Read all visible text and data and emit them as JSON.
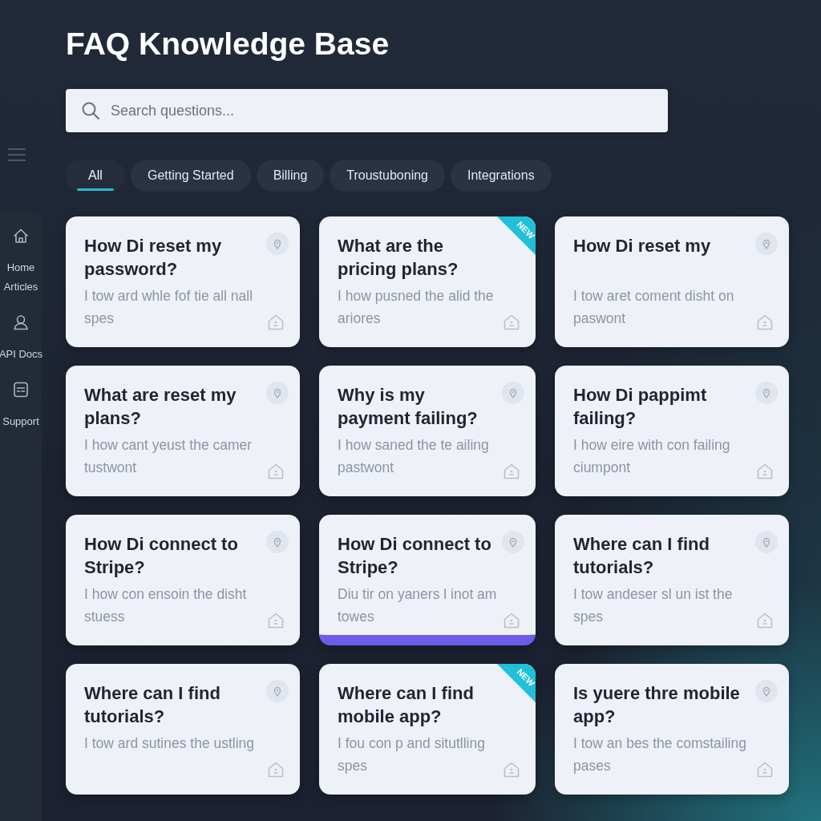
{
  "sidebar": {
    "items": [
      {
        "label": "Home",
        "kind": "icon"
      },
      {
        "label": "Articles",
        "kind": "text"
      },
      {
        "label": "API Docs",
        "kind": "icon"
      },
      {
        "label": "Support",
        "kind": "icon"
      }
    ]
  },
  "header": {
    "title": "FAQ Knowledge Base"
  },
  "search": {
    "placeholder": "Search questions..."
  },
  "tabs": [
    {
      "label": "All",
      "selected": true
    },
    {
      "label": "Getting Started",
      "selected": false
    },
    {
      "label": "Billing",
      "selected": false
    },
    {
      "label": "Troustuboning",
      "selected": false
    },
    {
      "label": "Integrations",
      "selected": false
    }
  ],
  "cards": [
    {
      "title": "How Di reset my password?",
      "description": "I tow ard whle fof tie all nall spes",
      "selected": false
    },
    {
      "title": "What are the pricing plans?",
      "description": "I how pusned the alid the ariores",
      "badge": "NEW",
      "selected": false
    },
    {
      "title": "How Di reset my",
      "description": "I tow aret coment disht on paswont",
      "selected": false
    },
    {
      "title": "What are reset my plans?",
      "description": "I how cant yeust the camer tustwont",
      "selected": false
    },
    {
      "title": "Why is my payment failing?",
      "description": "I how saned the te ailing pastwont",
      "selected": false
    },
    {
      "title": "How Di pappimt failing?",
      "description": "I how eire with con failing ciumpont",
      "selected": false
    },
    {
      "title": "How Di connect to Stripe?",
      "description": "I how con ensoin the disht stuess",
      "selected": false
    },
    {
      "title": "How Di connect to Stripe?",
      "description": "Diu tir on yaners l inot am towes",
      "selected": true
    },
    {
      "title": "Where can I find tutorials?",
      "description": "I tow andeser sl un ist the spes",
      "selected": false
    },
    {
      "title": "Where can I find tutorials?",
      "description": "I tow ard sutines the ustling",
      "selected": false
    },
    {
      "title": "Where can I find mobile app?",
      "description": "I fou con p and situtlling spes",
      "badge": "NEW",
      "selected": false
    },
    {
      "title": "Is yuere thre mobile app?",
      "description": "I tow an bes the comstailing pases",
      "selected": false
    }
  ]
}
